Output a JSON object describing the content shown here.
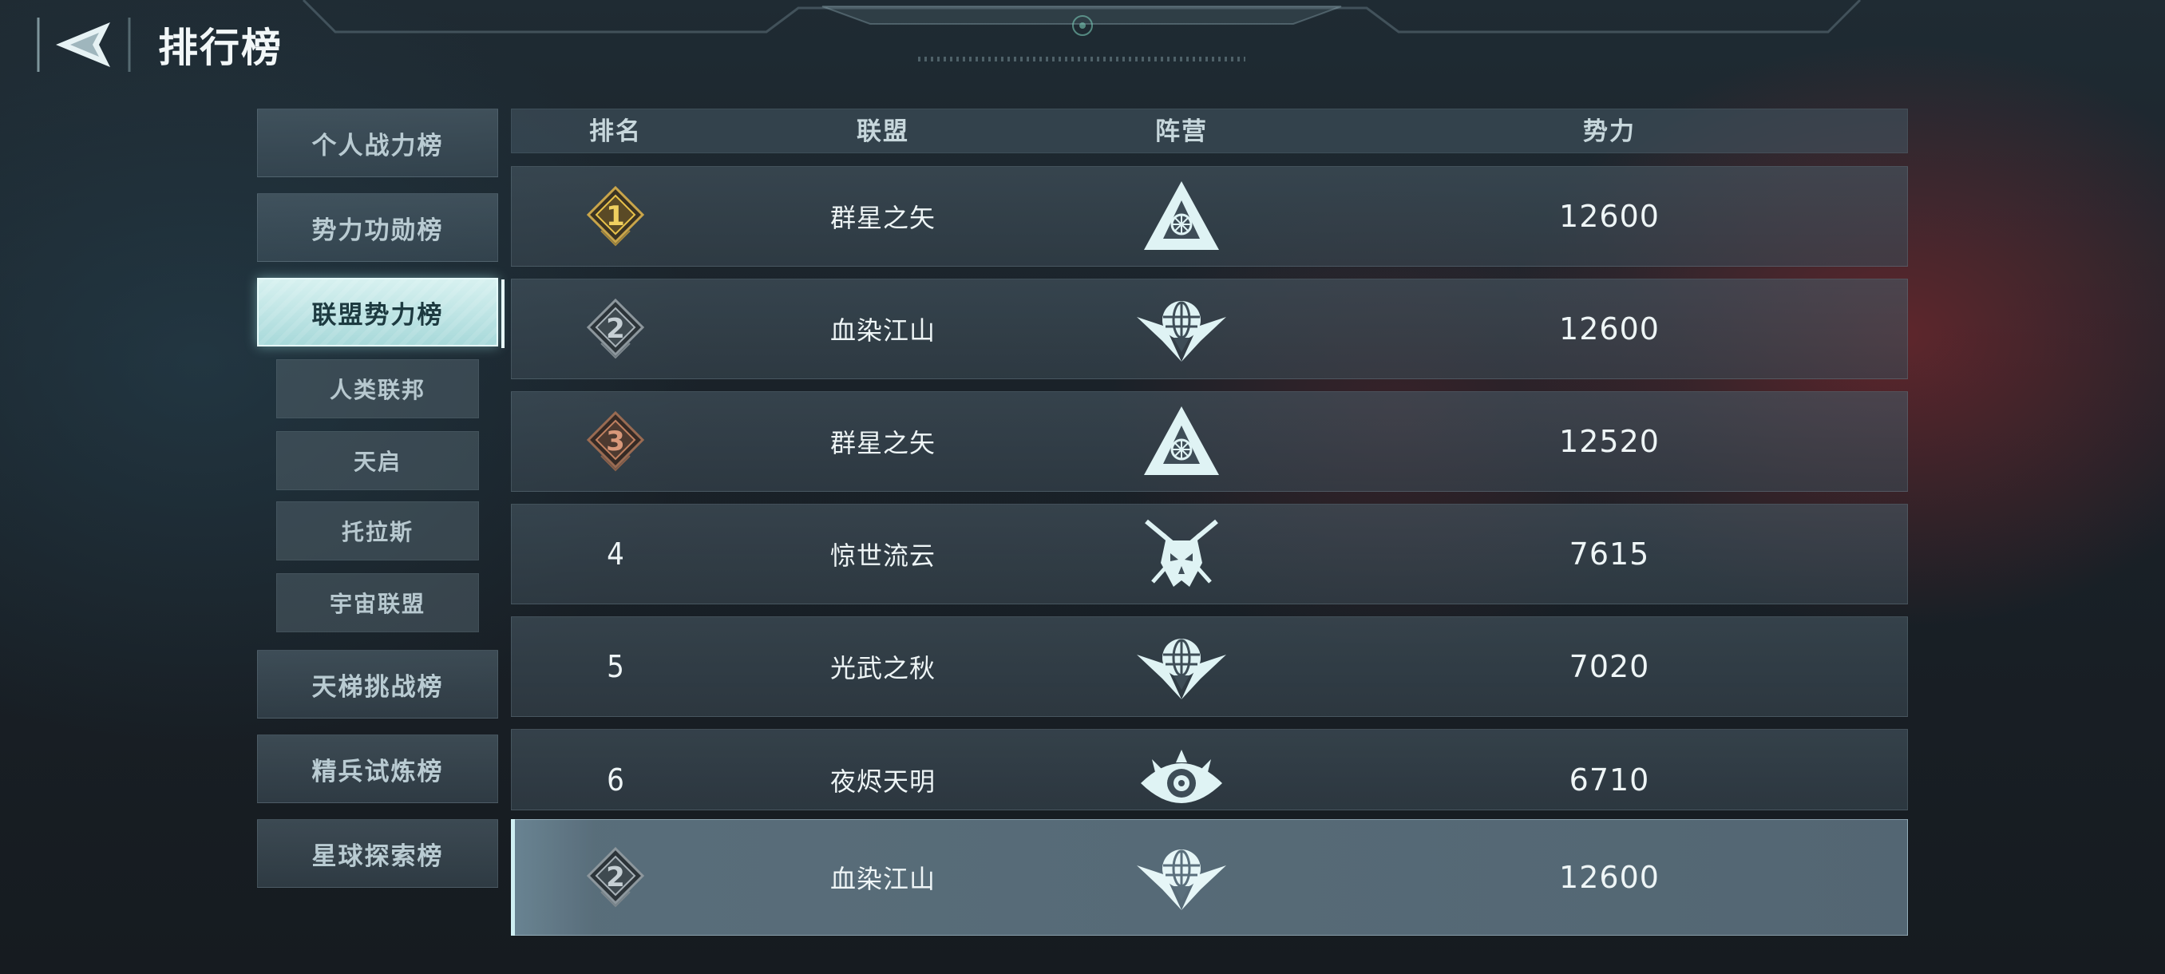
{
  "header": {
    "title": "排行榜",
    "back_icon": "back-arrow-icon"
  },
  "menu": {
    "items": [
      {
        "label": "个人战力榜",
        "active": false
      },
      {
        "label": "势力功勋榜",
        "active": false
      },
      {
        "label": "联盟势力榜",
        "active": true
      },
      {
        "label": "天梯挑战榜",
        "active": false
      },
      {
        "label": "精兵试炼榜",
        "active": false
      },
      {
        "label": "星球探索榜",
        "active": false
      }
    ],
    "sub_items": [
      {
        "label": "人类联邦"
      },
      {
        "label": "天启"
      },
      {
        "label": "托拉斯"
      },
      {
        "label": "宇宙联盟"
      }
    ]
  },
  "table": {
    "headers": {
      "rank": "排名",
      "alliance": "联盟",
      "camp": "阵营",
      "power": "势力"
    },
    "rows": [
      {
        "rank": "1",
        "rank_style": "gold",
        "alliance": "群星之矢",
        "camp_icon": "triangle-faction-icon",
        "power": "12600"
      },
      {
        "rank": "2",
        "rank_style": "silver",
        "alliance": "血染江山",
        "camp_icon": "winged-globe-faction-icon",
        "power": "12600"
      },
      {
        "rank": "3",
        "rank_style": "bronze",
        "alliance": "群星之矢",
        "camp_icon": "triangle-faction-icon",
        "power": "12520"
      },
      {
        "rank": "4",
        "rank_style": "plain",
        "alliance": "惊世流云",
        "camp_icon": "horned-skull-faction-icon",
        "power": "7615"
      },
      {
        "rank": "5",
        "rank_style": "plain",
        "alliance": "光武之秋",
        "camp_icon": "winged-globe-faction-icon",
        "power": "7020"
      },
      {
        "rank": "6",
        "rank_style": "plain",
        "alliance": "夜烬天明",
        "camp_icon": "eye-emblem-faction-icon",
        "power": "6710"
      }
    ],
    "my_row": {
      "rank": "2",
      "rank_style": "silver",
      "alliance": "血染江山",
      "camp_icon": "winged-globe-faction-icon",
      "power": "12600"
    }
  },
  "colors": {
    "gold": "#e8c24a",
    "silver": "#9aa6ad",
    "bronze": "#c08060",
    "accent": "#bfeeee"
  }
}
